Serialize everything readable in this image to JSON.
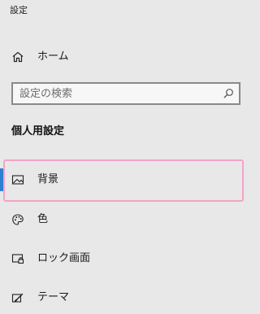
{
  "app": {
    "title": "設定"
  },
  "nav": {
    "home": {
      "label": "ホーム",
      "icon": "home-icon"
    }
  },
  "search": {
    "placeholder": "設定の検索",
    "value": "",
    "icon": "search-icon"
  },
  "section": {
    "title": "個人用設定",
    "selected_index": 0,
    "items": [
      {
        "label": "背景",
        "icon": "picture-icon"
      },
      {
        "label": "色",
        "icon": "palette-icon"
      },
      {
        "label": "ロック画面",
        "icon": "lock-screen-icon"
      },
      {
        "label": "テーマ",
        "icon": "theme-icon"
      }
    ]
  },
  "colors": {
    "background": "#e8e8e8",
    "accent": "#2f7fd0",
    "selection_outline": "#f2a4c6",
    "search_border": "#8a8a8a"
  }
}
